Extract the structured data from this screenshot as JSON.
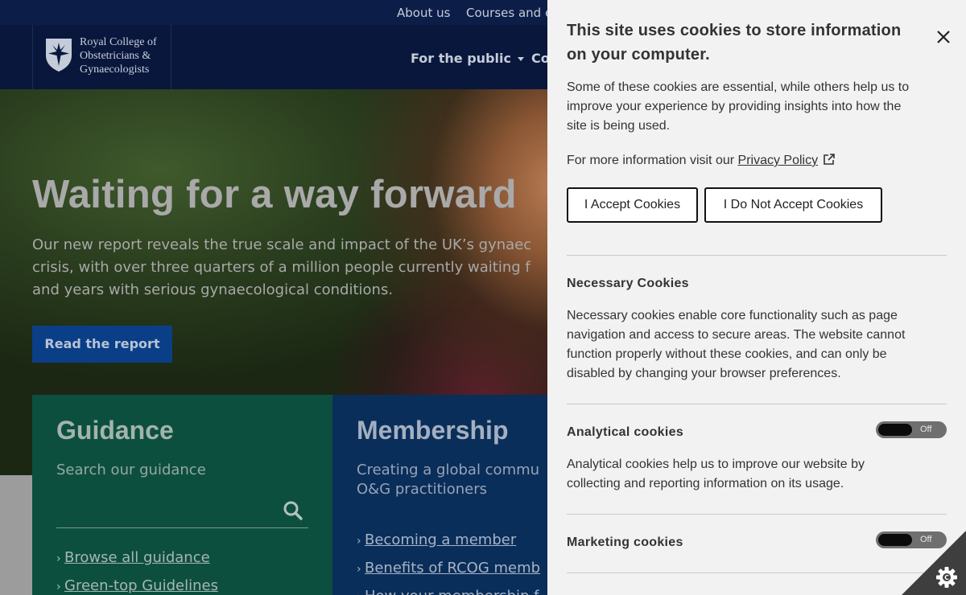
{
  "topbar": {
    "links": [
      "About us",
      "Courses and e"
    ]
  },
  "header": {
    "logo_lines": [
      "Royal College of",
      "Obstetricians &",
      "Gynaecologists"
    ],
    "nav": {
      "for_public": "For the public",
      "co": "Co"
    }
  },
  "hero": {
    "title": "Waiting for a way forward",
    "text_lines": [
      "Our new report reveals the true scale and impact of the UK’s gynaec",
      "crisis, with over three quarters of a million people currently waiting f",
      "and years with serious gynaecological conditions."
    ],
    "button": "Read the report"
  },
  "guidance": {
    "title": "Guidance",
    "subtitle": "Search our guidance",
    "search_value": "",
    "links": [
      "Browse all guidance",
      "Green-top Guidelines"
    ]
  },
  "membership": {
    "title": "Membership",
    "subtitle_lines": [
      "Creating a global commu",
      "O&G practitioners"
    ],
    "links": [
      "Becoming a member",
      "Benefits of RCOG memb",
      "How your membership f"
    ]
  },
  "cookie_panel": {
    "title_lines": [
      "This site uses cookies to store information",
      "on your computer."
    ],
    "intro_lines": [
      "Some of these cookies are essential, while others help us to",
      "improve your experience by providing insights into how the",
      "site is being used."
    ],
    "more_info_prefix": "For more information visit our ",
    "privacy_link": "Privacy Policy",
    "accept_button": "I Accept Cookies",
    "decline_button": "I Do Not Accept Cookies",
    "sections": [
      {
        "title": "Necessary Cookies",
        "text_lines": [
          "Necessary cookies enable core functionality such as page",
          "navigation and access to secure areas. The website cannot",
          "function properly without these cookies, and can only be",
          "disabled by changing your browser preferences."
        ]
      },
      {
        "title": "Analytical cookies",
        "toggle": "Off",
        "text_lines": [
          "Analytical cookies help us to improve our website by",
          "collecting and reporting information on its usage."
        ]
      },
      {
        "title": "Marketing cookies",
        "toggle": "Off"
      }
    ]
  },
  "colors": {
    "topbar": "#0c1e48",
    "header": "#09173d",
    "guidance_card": "#0d4f3f",
    "membership_card": "#0a2e5a",
    "hero_button": "#0a3e86",
    "cookie_panel_bg": "#f2f2f2"
  },
  "icons": [
    "shield-logo-icon",
    "caret-down-icon",
    "search-icon",
    "chevron-right-icon",
    "close-icon",
    "external-link-icon",
    "gear-icon"
  ]
}
